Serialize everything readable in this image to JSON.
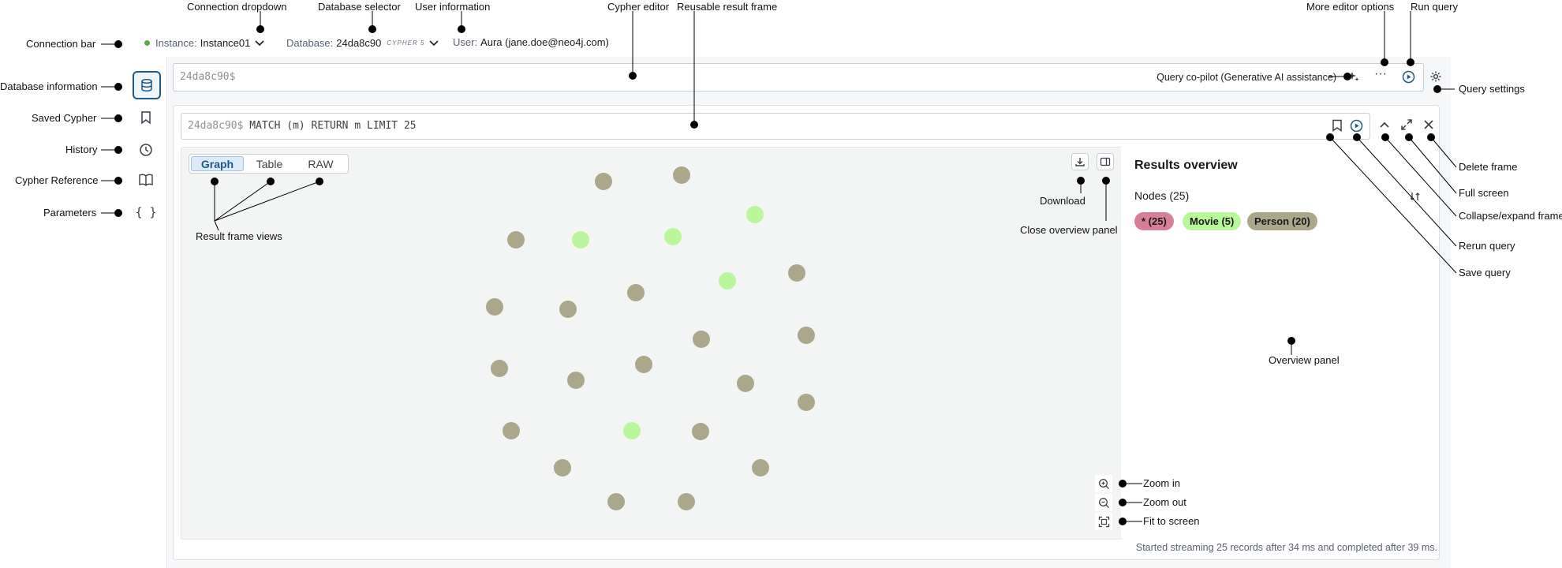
{
  "annotations": {
    "connection_dropdown": "Connection dropdown",
    "database_selector": "Database selector",
    "user_information": "User information",
    "cypher_editor": "Cypher editor",
    "reusable_result_frame": "Reusable result frame",
    "more_editor_options": "More editor options",
    "run_query": "Run query",
    "connection_bar": "Connection bar",
    "database_information": "Database information",
    "saved_cypher": "Saved Cypher",
    "history": "History",
    "cypher_reference": "Cypher Reference",
    "parameters": "Parameters",
    "query_settings": "Query settings",
    "delete_frame": "Delete frame",
    "full_screen": "Full screen",
    "collapse_expand_frame": "Collapse/expand frame",
    "rerun_query": "Rerun query",
    "save_query": "Save query",
    "download": "Download",
    "close_overview_panel": "Close overview panel",
    "result_frame_views": "Result frame views",
    "overview_panel": "Overview panel",
    "zoom_in": "Zoom in",
    "zoom_out": "Zoom out",
    "fit_to_screen": "Fit to screen"
  },
  "topbar": {
    "instance_label": "Instance:",
    "instance_value": "Instance01",
    "database_label": "Database:",
    "database_value": "24da8c90",
    "database_badge": "CYPHER 5",
    "user_label": "User:",
    "user_value": "Aura (jane.doe@neo4j.com)"
  },
  "editor": {
    "prompt": "24da8c90$",
    "copilot": "Query co-pilot (Generative AI assistance)"
  },
  "frame": {
    "prompt": "24da8c90$",
    "query": "MATCH (m) RETURN m LIMIT 25",
    "tabs": [
      "Graph",
      "Table",
      "RAW"
    ],
    "active_tab": "Graph"
  },
  "overview": {
    "title": "Results overview",
    "nodes_label": "Nodes (25)",
    "pills": [
      {
        "label": "* (25)",
        "color": "#d77e98"
      },
      {
        "label": "Movie (5)",
        "color": "#b8f79a"
      },
      {
        "label": "Person (20)",
        "color": "#aaa78a"
      }
    ]
  },
  "footer": "Started streaming 25 records after 34 ms and completed after 39 ms.",
  "colors": {
    "accent": "#1d5a8a",
    "person": "#aaa78a",
    "movie": "#b8f79a",
    "all": "#d77e98"
  }
}
